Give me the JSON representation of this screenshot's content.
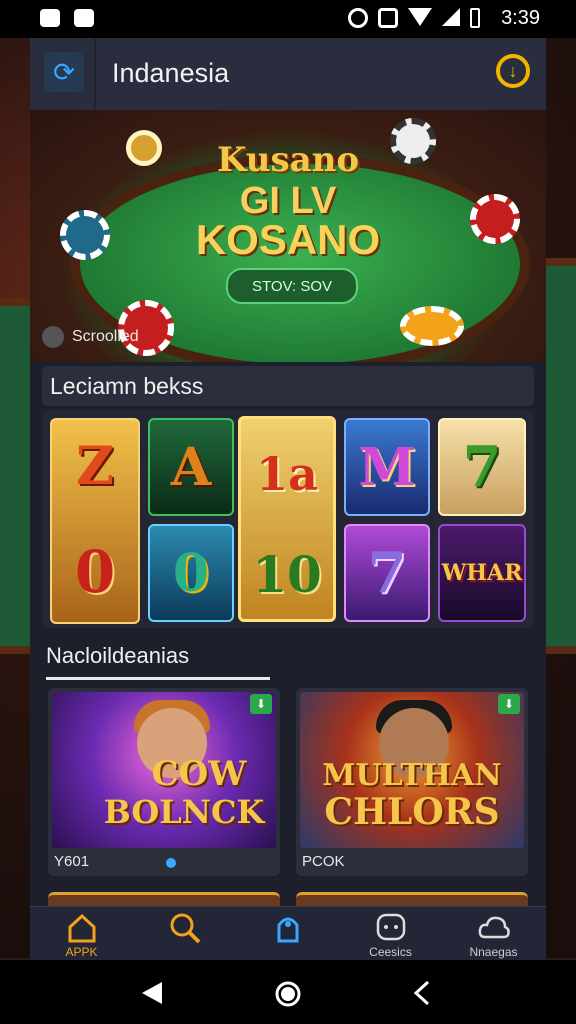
{
  "status_bar": {
    "time": "3:39"
  },
  "header": {
    "title": "Indanesia"
  },
  "hero": {
    "line1": "Kusano",
    "line2": "GI LV",
    "line3": "KOSANO",
    "button": "STOV: SOV",
    "tag": "Scroolled"
  },
  "section1": {
    "title": "Leciamn bekss"
  },
  "slots": [
    {
      "label": "Z"
    },
    {
      "label": "A"
    },
    {
      "label": "1a"
    },
    {
      "label": "M"
    },
    {
      "label": "7"
    },
    {
      "label": "0"
    },
    {
      "label": "0"
    },
    {
      "label": "10"
    },
    {
      "label": "7"
    },
    {
      "label": "WHAR"
    }
  ],
  "section2": {
    "title": "Nacloildeanias"
  },
  "cards": [
    {
      "title_a": "COW",
      "title_b": "BOLNCK",
      "caption": "Y601"
    },
    {
      "title_a": "MULTHAN",
      "title_b": "CHLORS",
      "caption": "PCOK"
    }
  ],
  "nav": [
    {
      "label": "APPK",
      "icon": "home-icon"
    },
    {
      "label": "",
      "icon": "search-icon"
    },
    {
      "label": "",
      "icon": "trophy-icon"
    },
    {
      "label": "Ceesics",
      "icon": "chat-icon"
    },
    {
      "label": "Nnaegas",
      "icon": "cloud-icon"
    }
  ]
}
